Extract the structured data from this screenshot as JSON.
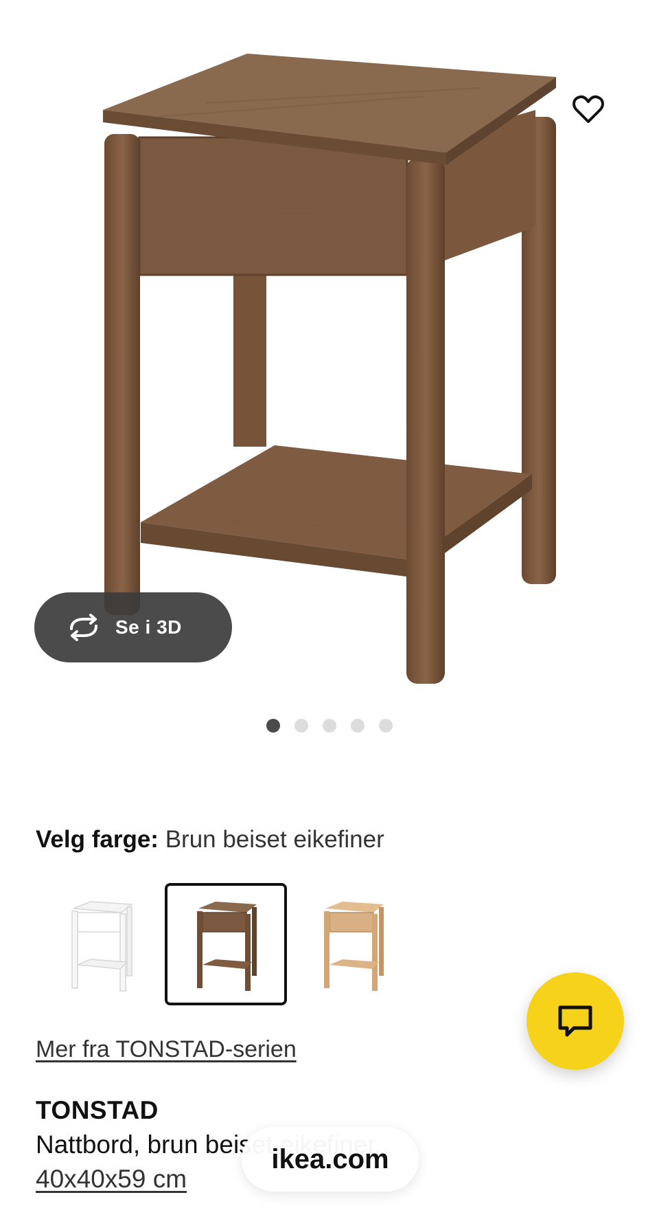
{
  "gallery": {
    "view_3d_label": "Se i 3D",
    "active_index": 0,
    "dots": [
      "image-1",
      "image-2",
      "image-3",
      "image-4",
      "image-5"
    ]
  },
  "color_picker": {
    "label": "Velg farge:",
    "selected_value": "Brun beiset eikefiner",
    "options": [
      "white",
      "brown",
      "oak"
    ]
  },
  "series_link": "Mer fra TONSTAD-serien",
  "product": {
    "name": "TONSTAD",
    "description": "Nattbord, brun beiset eikefiner,",
    "size": "40x40x59 cm"
  },
  "browser": {
    "url": "ikea.com"
  },
  "icons": {
    "favorite": "heart-icon",
    "view_3d": "rotate-icon",
    "chat": "chat-bubble-icon"
  },
  "colors": {
    "accent_yellow": "#f7d21b",
    "overlay_dark": "#3c3c3c",
    "wood_brown": "#7a5a40"
  }
}
